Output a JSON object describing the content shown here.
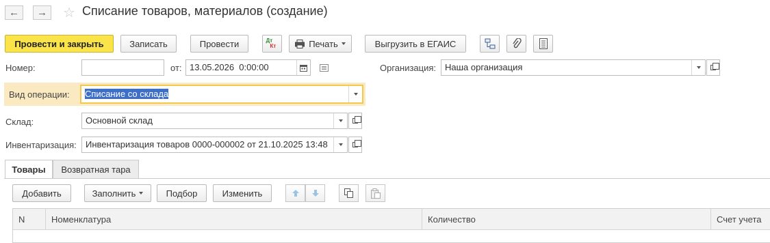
{
  "window": {
    "title": "Списание товаров, материалов (создание)"
  },
  "toolbar": {
    "post_close": "Провести и закрыть",
    "save": "Записать",
    "post": "Провести",
    "dt_kt_top": "Дт",
    "dt_kt_bottom": "Кт",
    "print": "Печать",
    "egais": "Выгрузить в ЕГАИС"
  },
  "form": {
    "number_label": "Номер:",
    "number_value": "",
    "date_label": "от:",
    "date_value": "13.05.2026  0:00:00",
    "org_label": "Организация:",
    "org_value": "Наша организация",
    "operation_label": "Вид операции:",
    "operation_value": "Списание со склада",
    "warehouse_label": "Склад:",
    "warehouse_value": "Основной склад",
    "inventory_label": "Инвентаризация:",
    "inventory_value": "Инвентаризация товаров 0000-000002 от 21.10.2025 13:48"
  },
  "tabs": [
    {
      "label": "Товары",
      "active": true
    },
    {
      "label": "Возвратная тара",
      "active": false
    }
  ],
  "table_toolbar": {
    "add": "Добавить",
    "fill": "Заполнить",
    "pick": "Подбор",
    "change": "Изменить"
  },
  "table": {
    "columns": [
      "N",
      "Номенклатура",
      "Количество",
      "Счет учета"
    ]
  },
  "colors": {
    "primary_button": "#fbe44a",
    "focus_border": "#f2c94c",
    "selection": "#3d6fc9"
  }
}
